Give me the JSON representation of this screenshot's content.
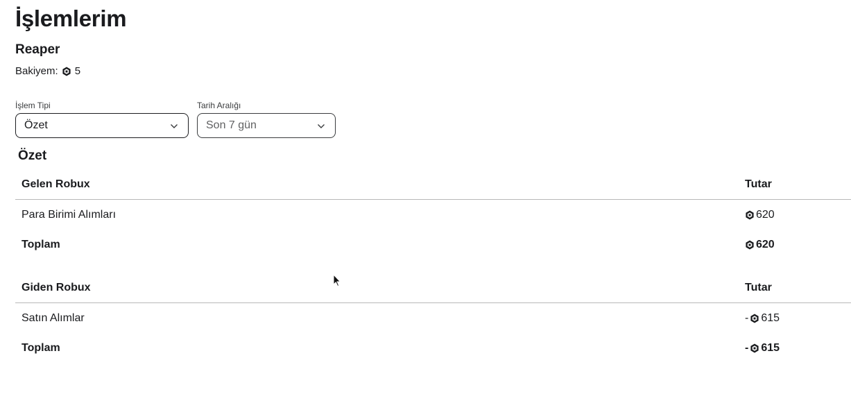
{
  "page": {
    "title": "İşlemlerim"
  },
  "user": {
    "name": "Reaper",
    "balance_label": "Bakiyem:",
    "balance_value": "5"
  },
  "filters": {
    "type": {
      "label": "İşlem Tipi",
      "value": "Özet"
    },
    "range": {
      "label": "Tarih Aralığı",
      "value": "Son 7 gün"
    }
  },
  "summary": {
    "title": "Özet",
    "incoming": {
      "header": "Gelen Robux",
      "amount_header": "Tutar",
      "rows": [
        {
          "label": "Para Birimi Alımları",
          "amount": "620"
        }
      ],
      "total": {
        "label": "Toplam",
        "amount": "620"
      }
    },
    "outgoing": {
      "header": "Giden Robux",
      "amount_header": "Tutar",
      "rows": [
        {
          "label": "Satın Alımlar",
          "sign": "-",
          "amount": "615"
        }
      ],
      "total": {
        "label": "Toplam",
        "sign": "-",
        "amount": "615"
      }
    }
  },
  "icons": {
    "robux": "robux-icon",
    "chevron": "chevron-down-icon",
    "cursor": "mouse-cursor-icon"
  }
}
